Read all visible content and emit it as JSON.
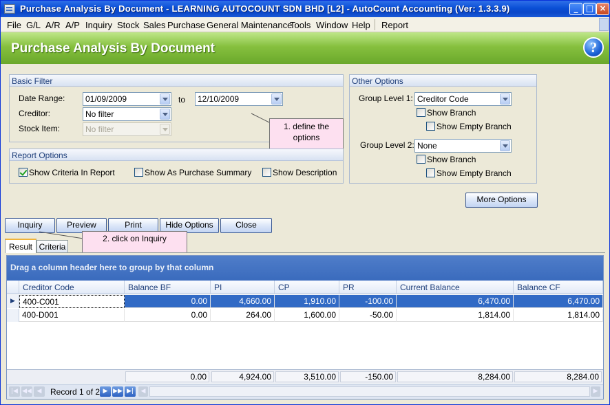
{
  "window": {
    "title": "Purchase Analysis By Document - LEARNING AUTOCOUNT SDN BHD [L2] - AutoCount Accounting (Ver: 1.3.3.9)"
  },
  "menu": {
    "items": [
      "File",
      "G/L",
      "A/R",
      "A/P",
      "Inquiry",
      "Stock",
      "Sales",
      "Purchase",
      "General Maintenance",
      "Tools",
      "Window",
      "Help",
      "Report"
    ]
  },
  "header": {
    "title": "Purchase Analysis By Document"
  },
  "basic_filter": {
    "title": "Basic Filter",
    "date_range_label": "Date Range:",
    "date_from": "01/09/2009",
    "to_label": "to",
    "date_to": "12/10/2009",
    "creditor_label": "Creditor:",
    "creditor_value": "No filter",
    "stock_item_label": "Stock Item:",
    "stock_item_value": "No filter"
  },
  "callout1": {
    "text": "1. define the options"
  },
  "report_options": {
    "title": "Report Options",
    "show_criteria": {
      "label": "Show Criteria In Report",
      "checked": true
    },
    "show_summary": {
      "label": "Show As Purchase Summary",
      "checked": false
    },
    "show_description": {
      "label": "Show Description",
      "checked": false
    }
  },
  "other_options": {
    "title": "Other Options",
    "group1_label": "Group Level 1:",
    "group1_value": "Creditor Code",
    "show_branch1": {
      "label": "Show Branch",
      "checked": false
    },
    "show_empty_branch1": {
      "label": "Show Empty Branch",
      "checked": false
    },
    "group2_label": "Group Level 2:",
    "group2_value": "None",
    "show_branch2": {
      "label": "Show Branch",
      "checked": false
    },
    "show_empty_branch2": {
      "label": "Show Empty Branch",
      "checked": false
    },
    "more_options": "More Options"
  },
  "actions": {
    "inquiry": "Inquiry",
    "preview": "Preview",
    "print": "Print",
    "hide_options": "Hide Options",
    "close": "Close"
  },
  "callout2": {
    "text": "2. click on Inquiry"
  },
  "tabs": {
    "result": "Result",
    "criteria": "Criteria"
  },
  "grid": {
    "group_hint": "Drag a column header here to group by that column",
    "columns": [
      "Creditor Code",
      "Balance BF",
      "PI",
      "CP",
      "PR",
      "Current Balance",
      "Balance CF"
    ],
    "rows": [
      [
        "400-C001",
        "0.00",
        "4,660.00",
        "1,910.00",
        "-100.00",
        "6,470.00",
        "6,470.00"
      ],
      [
        "400-D001",
        "0.00",
        "264.00",
        "1,600.00",
        "-50.00",
        "1,814.00",
        "1,814.00"
      ]
    ],
    "totals": [
      "0.00",
      "4,924.00",
      "3,510.00",
      "-150.00",
      "8,284.00",
      "8,284.00"
    ],
    "record_text": "Record 1 of 2"
  },
  "colors": {
    "header_green": "#86c03e",
    "selection": "#316ac5",
    "titlebar": "#0a4fd6",
    "callout": "#fde0f0"
  }
}
